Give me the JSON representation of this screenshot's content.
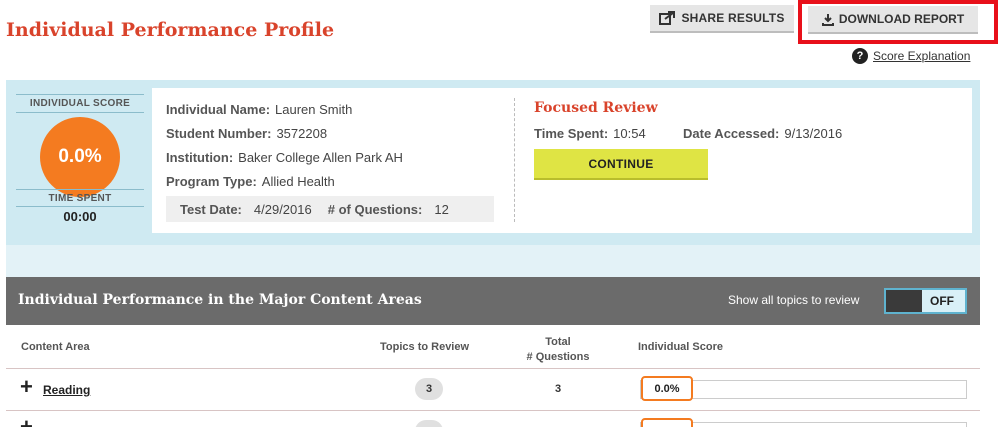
{
  "header": {
    "title": "Individual Performance Profile",
    "share_label": "SHARE RESULTS",
    "download_label": "DOWNLOAD REPORT",
    "score_explanation_label": "Score Explanation"
  },
  "score_panel": {
    "individual_score_label": "INDIVIDUAL SCORE",
    "individual_score_value": "0.0%",
    "time_spent_label": "TIME SPENT",
    "time_spent_value": "00:00"
  },
  "student": {
    "name_label": "Individual Name:",
    "name": "Lauren Smith",
    "number_label": "Student Number:",
    "number": "3572208",
    "institution_label": "Institution:",
    "institution": "Baker College Allen Park AH",
    "program_label": "Program Type:",
    "program": "Allied Health",
    "test_date_label": "Test Date:",
    "test_date": "4/29/2016",
    "questions_label": "# of Questions:",
    "questions": "12"
  },
  "focused_review": {
    "title": "Focused Review",
    "time_spent_label": "Time Spent:",
    "time_spent": "10:54",
    "date_accessed_label": "Date Accessed:",
    "date_accessed": "9/13/2016",
    "continue_label": "CONTINUE"
  },
  "content_areas": {
    "title": "Individual Performance in the Major Content Areas",
    "show_all_label": "Show all topics to review",
    "toggle_state": "OFF",
    "columns": {
      "content_area": "Content Area",
      "topics": "Topics to Review",
      "total": "Total\n# Questions",
      "score": "Individual Score"
    },
    "rows": [
      {
        "name": "Reading",
        "topics": "3",
        "total": "3",
        "score": "0.0%",
        "score_fraction": 0.0
      }
    ]
  },
  "colors": {
    "title_red": "#d9432b",
    "score_orange": "#f47b20",
    "continue_yellow": "#dfe444",
    "band_blue": "#cfeaf2",
    "header_gray": "#6b6b6b",
    "highlight_red": "#e8101a"
  },
  "icons": {
    "share": "share-icon",
    "download": "download-icon",
    "help": "question-circle-icon",
    "expand": "plus-icon"
  }
}
